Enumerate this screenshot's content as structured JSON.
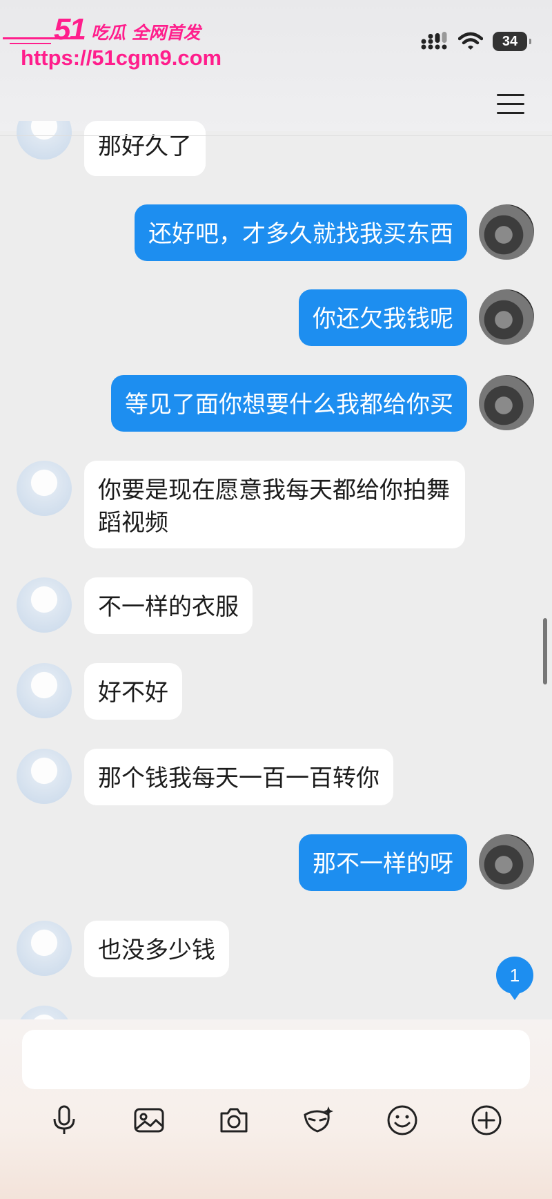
{
  "watermark": {
    "logo": "51",
    "slogan": "吃瓜 全网首发",
    "url": "https://51cgm9.com"
  },
  "status_bar": {
    "battery": "34"
  },
  "messages": [
    {
      "side": "left",
      "text": "那好久了"
    },
    {
      "side": "right",
      "text": "还好吧，才多久就找我买东西"
    },
    {
      "side": "right",
      "text": "你还欠我钱呢"
    },
    {
      "side": "right",
      "text": "等见了面你想要什么我都给你买"
    },
    {
      "side": "left",
      "text": "你要是现在愿意我每天都给你拍舞蹈视频"
    },
    {
      "side": "left",
      "text": "不一样的衣服"
    },
    {
      "side": "left",
      "text": "好不好"
    },
    {
      "side": "left",
      "text": "那个钱我每天一百一百转你"
    },
    {
      "side": "right",
      "text": "那不一样的呀"
    },
    {
      "side": "left",
      "text": "也没多少钱"
    }
  ],
  "unread_count": "1",
  "composer": {
    "placeholder": "",
    "tools": [
      "mic-icon",
      "image-icon",
      "camera-icon",
      "ai-mask-icon",
      "emoji-icon",
      "plus-icon"
    ]
  },
  "colors": {
    "sent_bubble": "#1d8ef0",
    "received_bubble": "#ffffff",
    "background": "#ededed",
    "watermark": "#ff1e8c"
  }
}
